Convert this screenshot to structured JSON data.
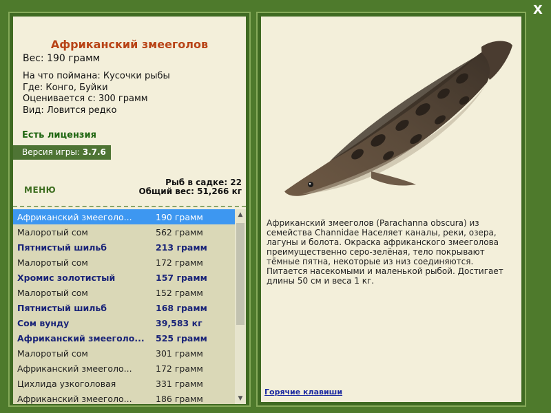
{
  "close_label": "X",
  "fish": {
    "title": "Африканский змееголов",
    "weight": "Вес: 190 грамм",
    "details": [
      "На что поймана: Кусочки рыбы",
      "Где: Конго, Буйки",
      "Оценивается с: 300 грамм",
      "Вид: Ловится редко"
    ],
    "description": "Африканский змееголов (Parachanna obscura) из семейства Channidae Населяет каналы, реки, озера, лагуны и болота. Окраска африканского змееголова преимущественно серо-зелёная, тело покрывают тёмные пятна, некоторые из низ соединяются. Питается насекомыми и маленькой рыбой. Достигает длины 50 см и веса 1 кг."
  },
  "license": "Есть лицензия",
  "version": {
    "label": "Версия игры:",
    "value": "3.7.6"
  },
  "menu_label": "МЕНЮ",
  "stats": {
    "in_keepnet": "Рыб в садке: 22",
    "total_weight": "Общий вес: 51,266 кг"
  },
  "fish_list": [
    {
      "name": "Африканский змееголо...",
      "weight": "190 грамм",
      "bold": false,
      "selected": true
    },
    {
      "name": "Малоротый сом",
      "weight": "562 грамм",
      "bold": false,
      "selected": false
    },
    {
      "name": "Пятнистый шильб",
      "weight": "213 грамм",
      "bold": true,
      "selected": false
    },
    {
      "name": "Малоротый сом",
      "weight": "172 грамм",
      "bold": false,
      "selected": false
    },
    {
      "name": "Хромис золотистый",
      "weight": "157 грамм",
      "bold": true,
      "selected": false
    },
    {
      "name": "Малоротый сом",
      "weight": "152 грамм",
      "bold": false,
      "selected": false
    },
    {
      "name": "Пятнистый шильб",
      "weight": "168 грамм",
      "bold": true,
      "selected": false
    },
    {
      "name": "Сом вунду",
      "weight": "39,583 кг",
      "bold": true,
      "selected": false
    },
    {
      "name": "Африканский змееголо...",
      "weight": "525 грамм",
      "bold": true,
      "selected": false
    },
    {
      "name": "Малоротый сом",
      "weight": "301 грамм",
      "bold": false,
      "selected": false
    },
    {
      "name": "Африканский змееголо...",
      "weight": "172 грамм",
      "bold": false,
      "selected": false
    },
    {
      "name": "Цихлида узкоголовая",
      "weight": "331 грамм",
      "bold": false,
      "selected": false
    },
    {
      "name": "Африканский змееголо...",
      "weight": "186 грамм",
      "bold": false,
      "selected": false
    }
  ],
  "hotkeys_label": "Горячие клавиши",
  "colors": {
    "background": "#4e7a2c",
    "panel": "#f3efda",
    "title": "#b84316",
    "selected_row": "#3d97f1",
    "bold_row": "#1a2478",
    "license": "#1f6611"
  },
  "icons": {
    "close": "close-icon",
    "scroll_up": "chevron-up-icon",
    "scroll_down": "chevron-down-icon"
  }
}
